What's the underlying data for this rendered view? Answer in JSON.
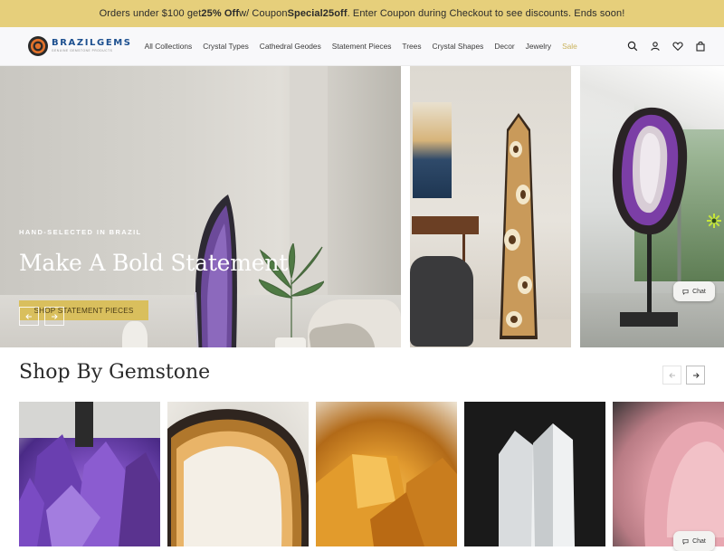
{
  "promo": {
    "prefix": "Orders under $100 get ",
    "highlight": "25% Off",
    "middle": " w/ Coupon ",
    "coupon": "Special25off",
    "suffix": ". Enter Coupon during Checkout to see discounts. Ends soon!",
    "background": "#e6cf7b"
  },
  "header": {
    "logo_name": "BRAZILGEMS",
    "logo_tagline": "GENUINE GEMSTONE PRODUCTS",
    "nav": [
      "All Collections",
      "Crystal Types",
      "Cathedral Geodes",
      "Statement Pieces",
      "Trees",
      "Crystal Shapes",
      "Decor",
      "Jewelry",
      "Sale"
    ],
    "icons": [
      "search-icon",
      "account-icon",
      "wishlist-heart-icon",
      "cart-bag-icon"
    ]
  },
  "hero": {
    "eyebrow": "HAND-SELECTED IN BRAZIL",
    "title": "Make A Bold Statement",
    "cta": "SHOP STATEMENT PIECES",
    "accent": "#d9bf5d"
  },
  "chat": {
    "label": "Chat"
  },
  "section": {
    "title": "Shop By Gemstone"
  },
  "cards": [
    "amethyst",
    "agate",
    "citrine",
    "quartz",
    "rose quartz"
  ]
}
